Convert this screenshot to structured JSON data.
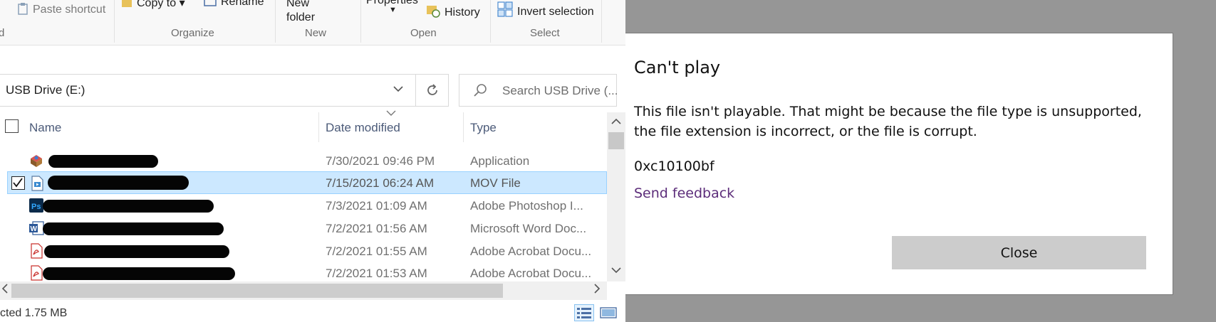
{
  "ribbon": {
    "items": {
      "paste_shortcut": "Paste shortcut",
      "copy_to": "Copy to",
      "rename": "Rename",
      "new_folder_line1": "New",
      "new_folder_line2": "folder",
      "properties": "Properties",
      "history": "History",
      "invert_selection": "Invert selection"
    },
    "groups": {
      "clipboard_fragment": "d",
      "organize": "Organize",
      "new": "New",
      "open": "Open",
      "select": "Select"
    }
  },
  "address": {
    "path": "USB Drive (E:)",
    "search_placeholder": "Search USB Drive (..."
  },
  "columns": {
    "name": "Name",
    "date_modified": "Date modified",
    "type": "Type"
  },
  "files": [
    {
      "name": "[redacted]",
      "date": "7/30/2021 09:46 PM",
      "type": "Application",
      "icon": "application-icon",
      "selected": false
    },
    {
      "name": "[redacted]",
      "date": "7/15/2021 06:24 AM",
      "type": "MOV File",
      "icon": "video-file-icon",
      "selected": true
    },
    {
      "name": "[redacted]",
      "date": "7/3/2021 01:09 AM",
      "type": "Adobe Photoshop I...",
      "icon": "photoshop-icon",
      "selected": false
    },
    {
      "name": "[redacted]",
      "date": "7/2/2021 01:56 AM",
      "type": "Microsoft Word Doc...",
      "icon": "word-icon",
      "selected": false
    },
    {
      "name": "[redacted]",
      "date": "7/2/2021 01:55 AM",
      "type": "Adobe Acrobat Docu...",
      "icon": "pdf-icon",
      "selected": false
    },
    {
      "name": "[redacted]",
      "date": "7/2/2021 01:53 AM",
      "type": "Adobe Acrobat Docu...",
      "icon": "pdf-icon",
      "selected": false
    }
  ],
  "status": {
    "text": "cted  1.75 MB"
  },
  "dialog": {
    "title": "Can't play",
    "message": "This file isn't playable. That might be because the file type is unsupported, the file extension is incorrect, or the file is corrupt.",
    "error_code": "0xc10100bf",
    "feedback_link": "Send feedback",
    "close_label": "Close"
  },
  "colors": {
    "selection_bg": "#cce8ff",
    "selection_border": "#99d1ff",
    "link": "#5c2d7a",
    "button_bg": "#cccccc",
    "backdrop": "#969696"
  }
}
